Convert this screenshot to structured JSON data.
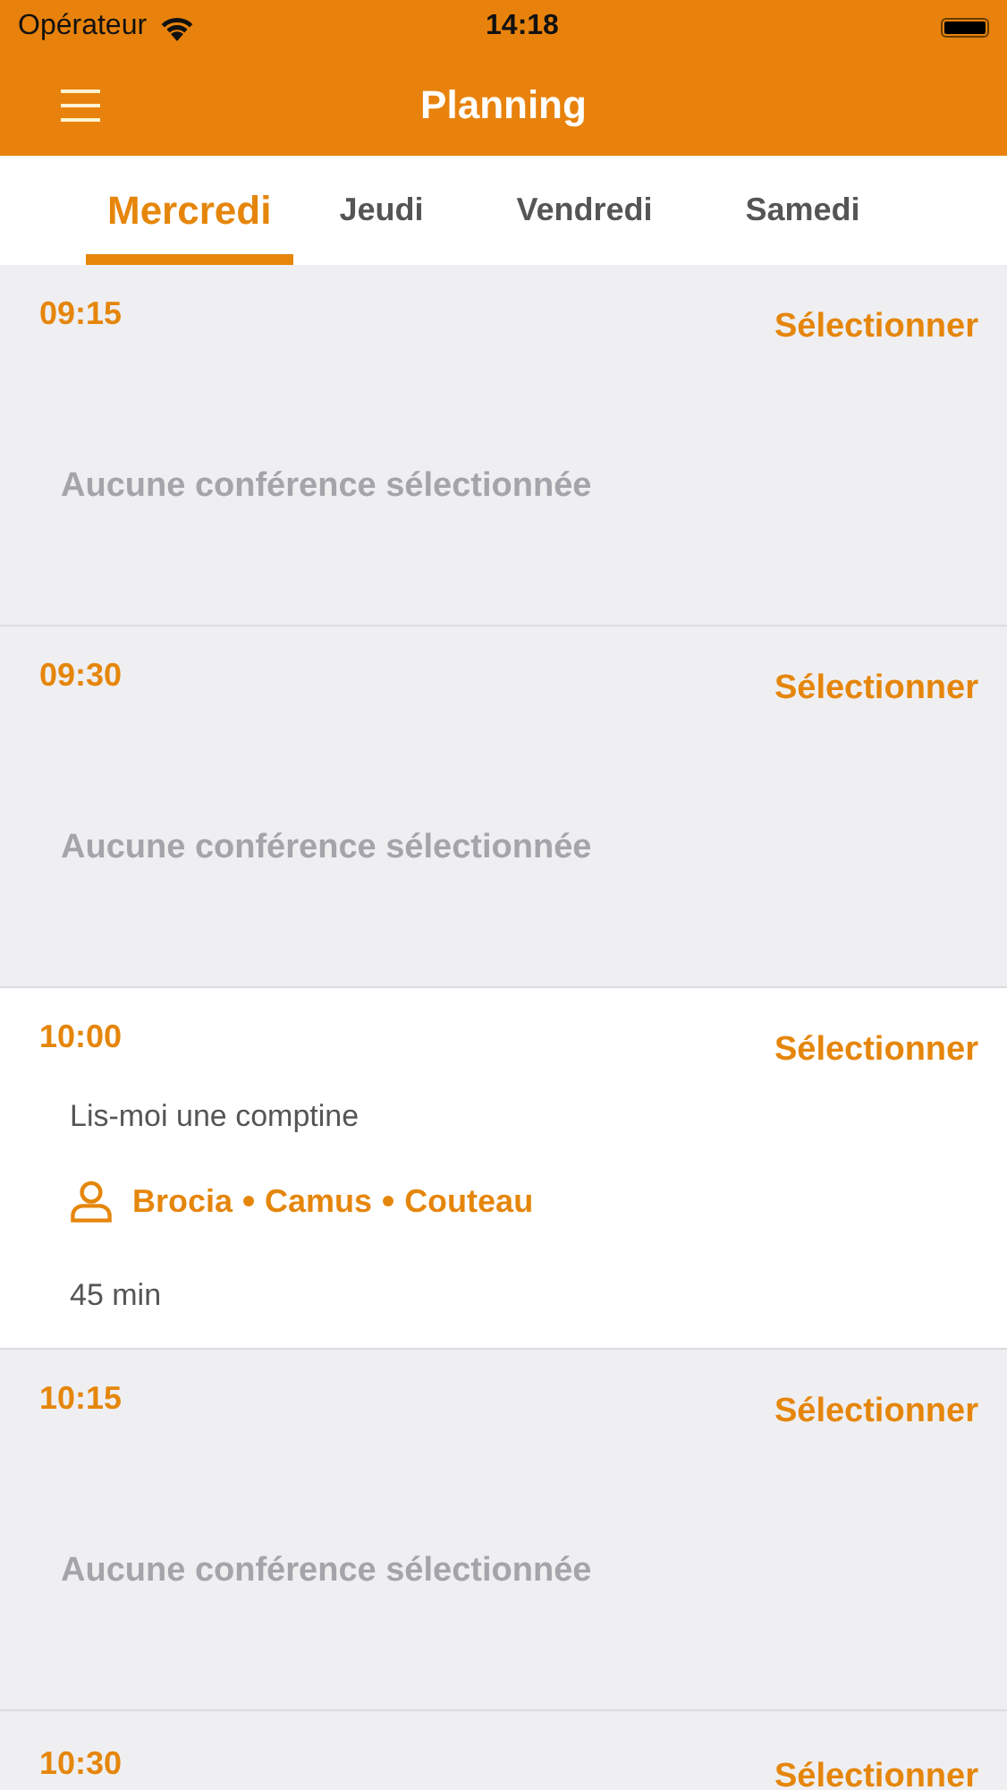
{
  "status_bar": {
    "carrier": "Opérateur",
    "time": "14:18"
  },
  "nav": {
    "title": "Planning"
  },
  "tabs": [
    {
      "label": "Mercredi",
      "selected": true
    },
    {
      "label": "Jeudi",
      "selected": false
    },
    {
      "label": "Vendredi",
      "selected": false
    },
    {
      "label": "Samedi",
      "selected": false
    }
  ],
  "slots": [
    {
      "kind": "empty",
      "time": "09:15",
      "action": "Sélectionner",
      "message": "Aucune conférence sélectionnée"
    },
    {
      "kind": "empty",
      "time": "09:30",
      "action": "Sélectionner",
      "message": "Aucune conférence sélectionnée"
    },
    {
      "kind": "talk",
      "time": "10:00",
      "action": "Sélectionner",
      "title": "Lis-moi une comptine",
      "speakers": [
        "Brocia",
        "Camus",
        "Couteau"
      ],
      "duration": "45 min"
    },
    {
      "kind": "empty",
      "time": "10:15",
      "action": "Sélectionner",
      "message": "Aucune conférence sélectionnée"
    },
    {
      "kind": "partial",
      "time": "10:30",
      "action": "Sélectionner"
    }
  ]
}
